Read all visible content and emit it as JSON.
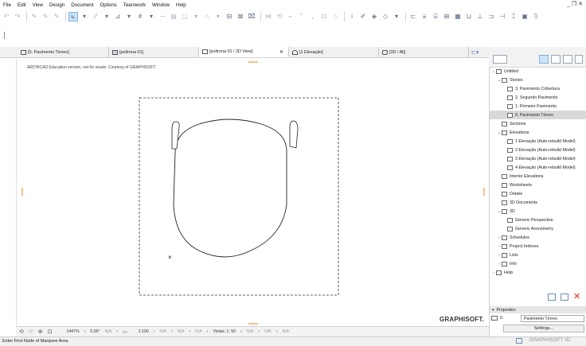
{
  "menubar": {
    "items": [
      "File",
      "Edit",
      "View",
      "Design",
      "Document",
      "Options",
      "Teamwork",
      "Window",
      "Help"
    ],
    "window_controls": "_ ❐ ✕"
  },
  "tabs": [
    {
      "label": "[0. Pavimento Térreo]",
      "active": false
    },
    {
      "label": "[poltrona 01]",
      "active": false
    },
    {
      "label": "[poltrona 01 / 2D View]",
      "active": true,
      "close": "✕"
    },
    {
      "label": "[1 Elevação]",
      "active": false
    },
    {
      "label": "[3D / All]",
      "active": false
    }
  ],
  "canvas": {
    "education_notice": "ARCHICAD Education version, not for resale. Courtesy of GRAPHISOFT.",
    "logo_text": "GRAPHISOFT.",
    "marker_symbol": "×"
  },
  "bottombar": {
    "zoom": "1447%",
    "angle": "0,00°",
    "scale": "1:100",
    "na1": "N/A",
    "na2": "N/A",
    "na3": "N/A",
    "na4": "N/A",
    "vistas": "Vistas: 1: 50",
    "na5": "N/A",
    "na6": "N/A",
    "na7": "N/A"
  },
  "statusbar": {
    "text": "Enter First Node of Marquee Area.",
    "graphisoft_id": "GRAPHISOFT ID"
  },
  "navigator": {
    "items": [
      {
        "label": "Untitled",
        "depth": 0,
        "chev": "⌄"
      },
      {
        "label": "Stories",
        "depth": 1,
        "chev": "⌄"
      },
      {
        "label": "3. Pavimento Cobertura",
        "depth": 2,
        "chev": ""
      },
      {
        "label": "2. Segundo Pavimento",
        "depth": 2,
        "chev": ""
      },
      {
        "label": "1. Primeiro Pavimento",
        "depth": 2,
        "chev": ""
      },
      {
        "label": "0. Pavimento Térreo",
        "depth": 2,
        "chev": "",
        "selected": true
      },
      {
        "label": "Sections",
        "depth": 1,
        "chev": ""
      },
      {
        "label": "Elevations",
        "depth": 1,
        "chev": "⌄"
      },
      {
        "label": "1 Elevação (Auto-rebuild Model)",
        "depth": 2,
        "chev": ""
      },
      {
        "label": "2 Elevação (Auto-rebuild Model)",
        "depth": 2,
        "chev": ""
      },
      {
        "label": "3 Elevação (Auto-rebuild Model)",
        "depth": 2,
        "chev": ""
      },
      {
        "label": "4 Elevação (Auto-rebuild Model)",
        "depth": 2,
        "chev": ""
      },
      {
        "label": "Interior Elevations",
        "depth": 1,
        "chev": ""
      },
      {
        "label": "Worksheets",
        "depth": 1,
        "chev": ""
      },
      {
        "label": "Details",
        "depth": 1,
        "chev": ""
      },
      {
        "label": "3D Documents",
        "depth": 1,
        "chev": ""
      },
      {
        "label": "3D",
        "depth": 1,
        "chev": "⌄"
      },
      {
        "label": "Generic Perspective",
        "depth": 2,
        "chev": ""
      },
      {
        "label": "Generic Axonometry",
        "depth": 2,
        "chev": ""
      },
      {
        "label": "Schedules",
        "depth": 1,
        "chev": "›"
      },
      {
        "label": "Project Indexes",
        "depth": 1,
        "chev": "›"
      },
      {
        "label": "Lists",
        "depth": 1,
        "chev": "›"
      },
      {
        "label": "Info",
        "depth": 1,
        "chev": "›"
      },
      {
        "label": "Help",
        "depth": 0,
        "chev": "›"
      }
    ]
  },
  "properties": {
    "header": "Properties",
    "story_label": "0.",
    "story_value": "Pavimento Térreo",
    "settings_button": "Settings..."
  },
  "colors": {
    "accent": "#cfe3f7",
    "close_red": "#d9342b",
    "grip_orange": "#f3c08a"
  }
}
